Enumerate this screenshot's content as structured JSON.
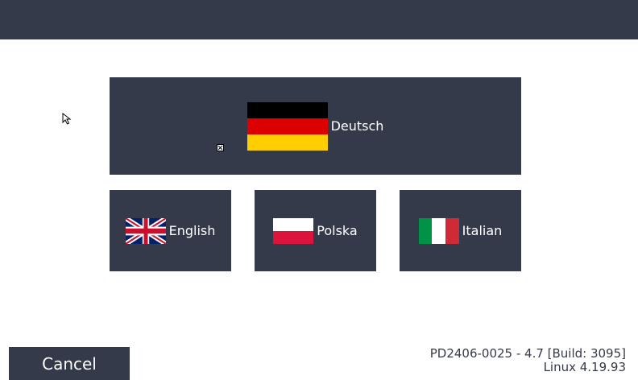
{
  "languages": {
    "german": {
      "label": "Deutsch",
      "flag_colors": [
        "#000000",
        "#dd0000",
        "#ffce00"
      ]
    },
    "english": {
      "label": "English",
      "flag_colors": [
        "#012169",
        "#ffffff",
        "#c8102e"
      ]
    },
    "polish": {
      "label": "Polska",
      "flag_colors": [
        "#ffffff",
        "#dc143c"
      ]
    },
    "italian": {
      "label": "Italian",
      "flag_colors": [
        "#009246",
        "#ffffff",
        "#ce2b37"
      ]
    }
  },
  "footer": {
    "cancel_label": "Cancel",
    "version_line1": "PD2406-0025 - 4.7 [Build: 3095]",
    "version_line2": "Linux 4.19.93"
  },
  "theme": {
    "panel_color": "#353a4a",
    "background": "#ffffff"
  },
  "icons": [
    "mouse-cursor-icon",
    "touch-indicator-icon",
    "flag-de-icon",
    "flag-uk-icon",
    "flag-pl-icon",
    "flag-it-icon"
  ]
}
